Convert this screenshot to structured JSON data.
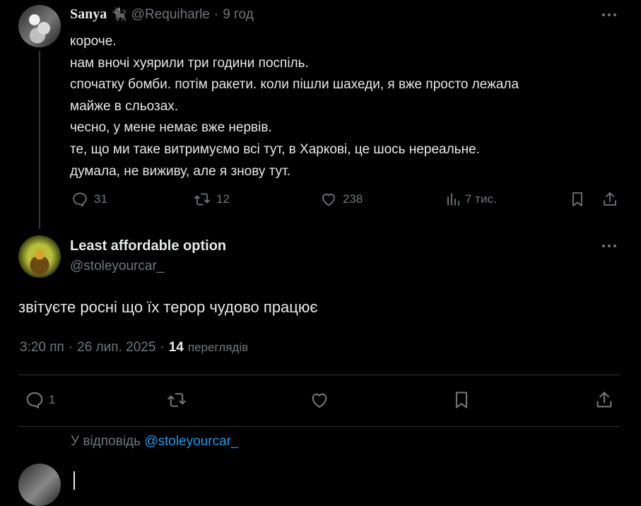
{
  "tweet1": {
    "display_name": "Sanya",
    "name_emoji": "🐈‍⬛",
    "handle": "@Requiharle",
    "separator": "·",
    "time": "9 год",
    "lines": [
      "короче.",
      "нам вночі хуярили три години поспіль.",
      "спочатку бомби. потім ракети. коли пішли шахеди, я вже просто лежала",
      "майже в сльозах.",
      "чесно, у мене немає вже нервів.",
      "те, що ми таке витримуємо всі тут, в Харкові, це шось нереальне.",
      "думала, не виживу, але я знову тут."
    ],
    "actions": {
      "replies": "31",
      "reposts": "12",
      "likes": "238",
      "views": "7 тис."
    }
  },
  "tweet2": {
    "display_name": "Least affordable option",
    "handle": "@stoleyourcar_",
    "text": "звітуєте росні що їх терор чудово працює",
    "time": "3:20 пп",
    "separator": "·",
    "date": "26 лип. 2025",
    "views_count": "14",
    "views_label": "переглядів",
    "actions": {
      "replies": "1"
    }
  },
  "reply_box": {
    "prefix": "У відповідь",
    "mention": "@stoleyourcar_"
  },
  "icons": {
    "reply": "reply-icon",
    "repost": "repost-icon",
    "like": "heart-icon",
    "views": "views-icon",
    "bookmark": "bookmark-icon",
    "share": "share-icon",
    "more": "more-icon"
  },
  "colors": {
    "background": "#000000",
    "text": "#e7e9ea",
    "muted": "#71767b",
    "link": "#1d9bf0",
    "divider": "#2f3336"
  }
}
